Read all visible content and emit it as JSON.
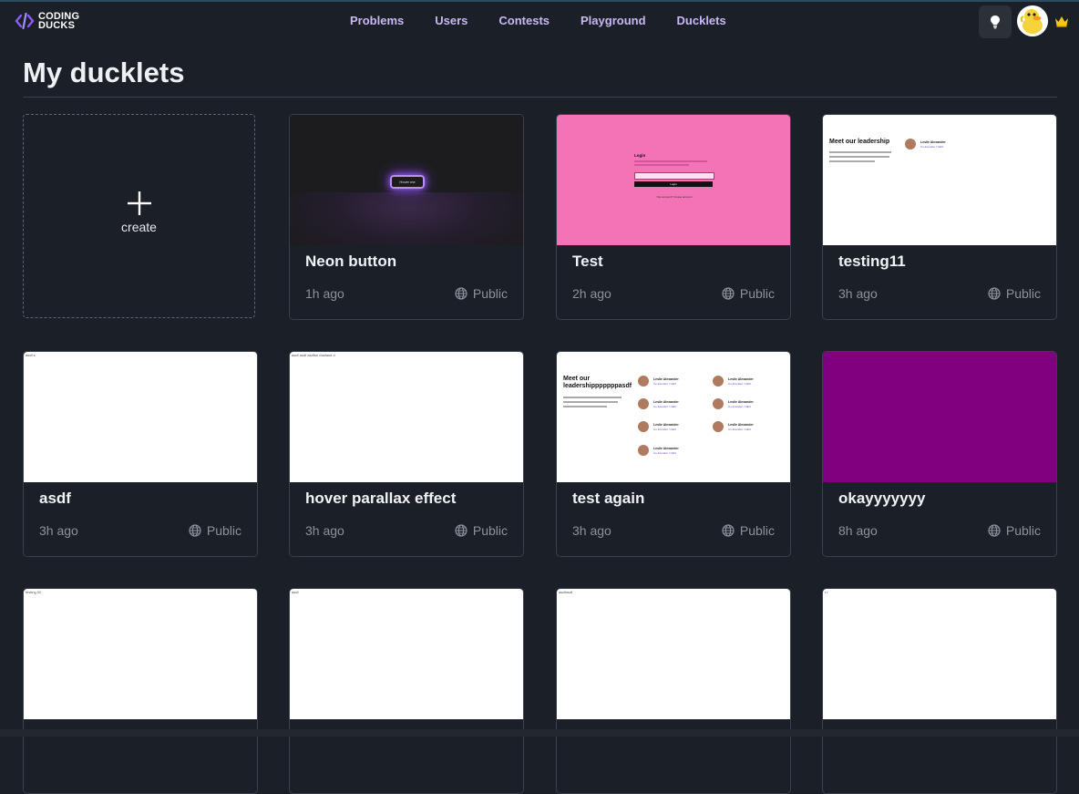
{
  "brand": {
    "line1": "CODING",
    "line2": "DUCKS"
  },
  "nav": [
    {
      "label": "Problems"
    },
    {
      "label": "Users"
    },
    {
      "label": "Contests"
    },
    {
      "label": "Playground"
    },
    {
      "label": "Ducklets"
    }
  ],
  "page": {
    "title": "My ducklets"
  },
  "create": {
    "label": "create"
  },
  "cards": [
    {
      "title": "Neon button",
      "time": "1h ago",
      "visibility": "Public",
      "thumb_text": "Hover me"
    },
    {
      "title": "Test",
      "time": "2h ago",
      "visibility": "Public",
      "thumb_title": "Login",
      "thumb_button": "Login",
      "thumb_footer": "Not account? Create account"
    },
    {
      "title": "testing11",
      "time": "3h ago",
      "visibility": "Public",
      "thumb_heading": "Meet our leadership",
      "thumb_person": "Leslie Alexander",
      "thumb_role": "Co-Founder / CEO"
    },
    {
      "title": "asdf",
      "time": "3h ago",
      "visibility": "Public",
      "thumb_text": "asdf s"
    },
    {
      "title": "hover parallax effect",
      "time": "3h ago",
      "visibility": "Public",
      "thumb_text": "asdf asdf asdfsn dasfasd d"
    },
    {
      "title": "test again",
      "time": "3h ago",
      "visibility": "Public",
      "thumb_heading": "Meet our leadershipppppppasdf",
      "thumb_person": "Leslie Alexander",
      "thumb_role": "Co-Founder / CEO"
    },
    {
      "title": "okayyyyyyy",
      "time": "8h ago",
      "visibility": "Public",
      "thumb_color": "#800080"
    },
    {
      "title": "",
      "time": "",
      "visibility": "",
      "thumb_text": "testing 00"
    },
    {
      "title": "",
      "time": "",
      "visibility": "",
      "thumb_text": "asdf"
    },
    {
      "title": "",
      "time": "",
      "visibility": "",
      "thumb_text": "asdfasdf"
    },
    {
      "title": "",
      "time": "",
      "visibility": "",
      "thumb_text": "t t"
    }
  ],
  "colors": {
    "background": "#1b1f27",
    "nav_link": "#c9b8f5",
    "accent": "#7c5cd6",
    "crown": "#f5c518",
    "test_thumb": "#f472b6"
  },
  "icons": [
    "code-brackets-icon",
    "lightbulb-icon",
    "duck-avatar-icon",
    "crown-icon",
    "plus-icon",
    "globe-icon"
  ]
}
